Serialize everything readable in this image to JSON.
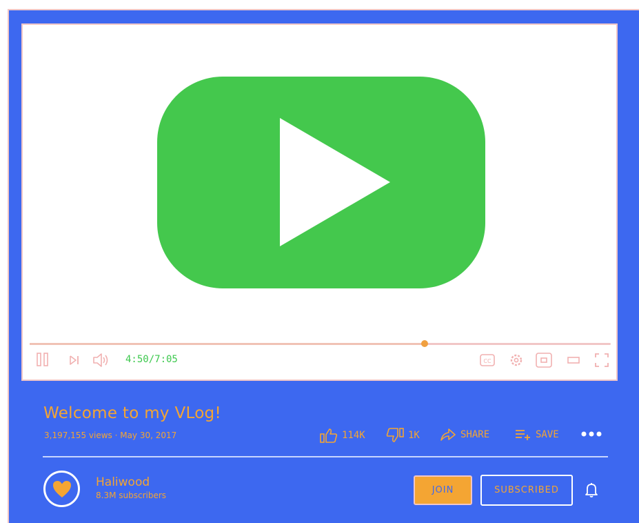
{
  "player": {
    "time_display": "4:50/7:05",
    "progress_fraction": 0.68
  },
  "video": {
    "title": "Welcome to my VLog!",
    "meta": "3,197,155 views · May 30, 2017"
  },
  "actions": {
    "likes": "114K",
    "dislikes": "1K",
    "share_label": "SHARE",
    "save_label": "SAVE"
  },
  "channel": {
    "name": "Haliwood",
    "subscribers": "8.3M subscribers"
  },
  "buttons": {
    "join_label": "JOIN",
    "subscribed_label": "SUBSCRIBED"
  },
  "colors": {
    "background": "#3d68f0",
    "accent": "#f4a533",
    "play_green": "#44c84d",
    "outline": "#f1c6c6"
  },
  "icons": [
    "play-icon",
    "pause-icon",
    "next-icon",
    "volume-icon",
    "captions-icon",
    "settings-icon",
    "miniplayer-icon",
    "theater-icon",
    "fullscreen-icon",
    "thumbs-up-icon",
    "thumbs-down-icon",
    "share-icon",
    "save-icon",
    "more-icon",
    "heart-icon",
    "bell-icon"
  ]
}
